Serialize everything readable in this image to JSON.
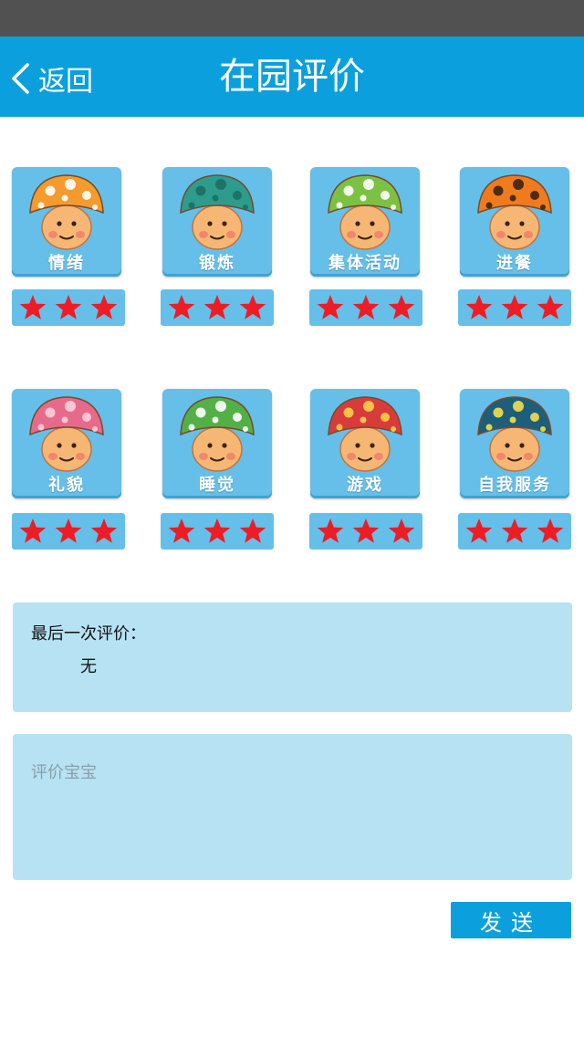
{
  "header": {
    "back_label": "返回",
    "title": "在园评价"
  },
  "categories": [
    {
      "label": "情绪",
      "rating": 3,
      "max": 3,
      "cap": "#f59a2c",
      "dot": "#ffffff",
      "icon": "mushroom-flower-icon"
    },
    {
      "label": "锻炼",
      "rating": 3,
      "max": 3,
      "cap": "#2d9c8c",
      "dot": "#1c6f63",
      "icon": "mushroom-goggles-icon"
    },
    {
      "label": "集体活动",
      "rating": 3,
      "max": 3,
      "cap": "#7cc242",
      "dot": "#ffffff",
      "icon": "mushroom-glasses-icon"
    },
    {
      "label": "进餐",
      "rating": 3,
      "max": 3,
      "cap": "#f07b1e",
      "dot": "#3b2414",
      "icon": "mushroom-checkered-icon"
    },
    {
      "label": "礼貌",
      "rating": 3,
      "max": 3,
      "cap": "#e86a8a",
      "dot": "#fbd0dc",
      "icon": "mushroom-pink-icon"
    },
    {
      "label": "睡觉",
      "rating": 3,
      "max": 3,
      "cap": "#52b046",
      "dot": "#ffffff",
      "icon": "mushroom-sleepy-icon"
    },
    {
      "label": "游戏",
      "rating": 3,
      "max": 3,
      "cap": "#d93b3b",
      "dot": "#f6d24a",
      "icon": "mushroom-festive-icon"
    },
    {
      "label": "自我服务",
      "rating": 3,
      "max": 3,
      "cap": "#1d5f7a",
      "dot": "#f4e04d",
      "icon": "mushroom-stars-icon"
    }
  ],
  "last_evaluation": {
    "title": "最后一次评价：",
    "value": "无"
  },
  "note": {
    "placeholder": "评价宝宝",
    "value": ""
  },
  "send_label": "发送",
  "colors": {
    "nav": "#0ba0dd",
    "status_bar": "#515151",
    "tile": "#65bfe9",
    "star": "#ee1c25",
    "panel": "#b6e2f4"
  }
}
